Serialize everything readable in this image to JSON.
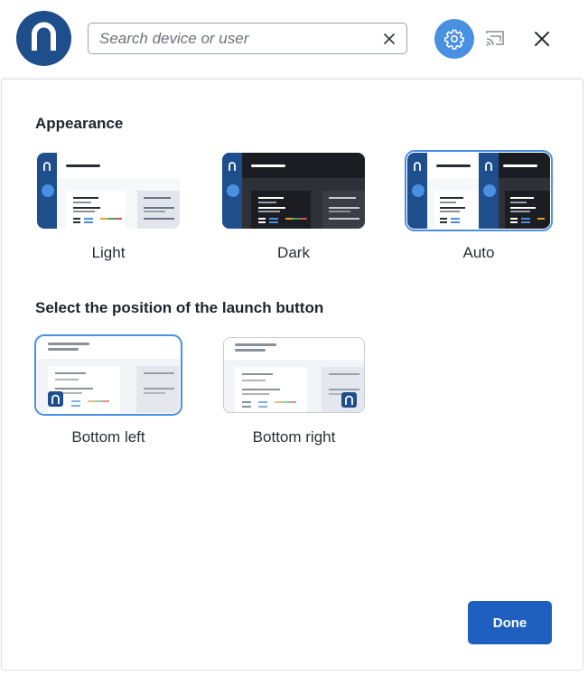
{
  "search": {
    "placeholder": "Search device or user"
  },
  "icons": {
    "logo": "n-logo-icon",
    "settings": "gear-icon",
    "cast": "cast-icon",
    "close": "close-icon",
    "clear": "clear-icon"
  },
  "colors": {
    "brand": "#1e4e8c",
    "accent": "#4a90e2",
    "primary_button": "#1f5fbf"
  },
  "appearance": {
    "title": "Appearance",
    "options": [
      {
        "label": "Light",
        "selected": false
      },
      {
        "label": "Dark",
        "selected": false
      },
      {
        "label": "Auto",
        "selected": true
      }
    ]
  },
  "launch_position": {
    "title": "Select the position of the launch button",
    "options": [
      {
        "label": "Bottom left",
        "selected": true
      },
      {
        "label": "Bottom right",
        "selected": false
      }
    ]
  },
  "footer": {
    "done_label": "Done"
  }
}
